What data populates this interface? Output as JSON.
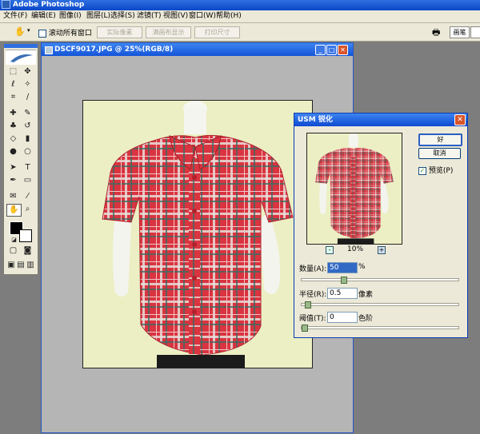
{
  "app": {
    "title": "Adobe Photoshop"
  },
  "menu": [
    "文件(F)",
    "编辑(E)",
    "图像(I)",
    "图层(L)",
    "选择(S)",
    "滤镜(T)",
    "视图(V)",
    "窗口(W)",
    "帮助(H)"
  ],
  "options": {
    "scroll_all": "滚动所有窗口",
    "actual_pixels": "实际像素",
    "fit_on_screen": "满画布显示",
    "print_size": "打印尺寸",
    "palette_tab": "画笔"
  },
  "document": {
    "title": "DSCF9017.JPG @ 25%(RGB/8)"
  },
  "usm": {
    "title": "USM 锐化",
    "ok": "好",
    "cancel": "取消",
    "preview": "预览(P)",
    "zoom_out": "-",
    "zoom_in": "+",
    "zoom": "10%",
    "amount_label": "数量(A):",
    "amount_value": "50",
    "amount_unit": "%",
    "amount_level": 0.26,
    "radius_label": "半径(R):",
    "radius_value": "0.5",
    "radius_unit": "像素",
    "radius_level": 0.02,
    "threshold_label": "阈值(T):",
    "threshold_value": "0",
    "threshold_unit": "色阶",
    "threshold_level": 0.0
  },
  "colors": {
    "shirt": "#d9343f",
    "background": "#ecefc4",
    "titlebar": "#1554d8"
  }
}
